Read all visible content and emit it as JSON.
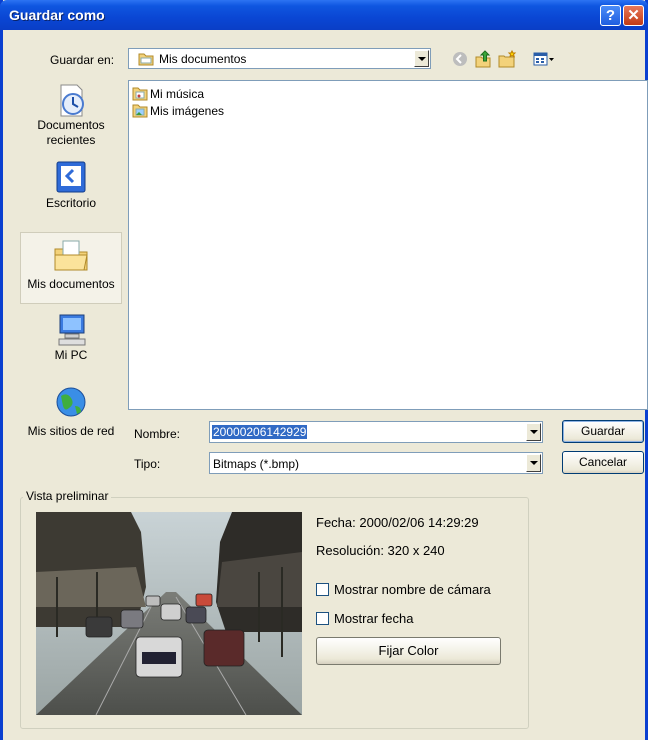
{
  "window": {
    "title": "Guardar como",
    "help_glyph": "?",
    "close_glyph": "✕"
  },
  "lookin": {
    "label": "Guardar en:",
    "value": "Mis documentos"
  },
  "toolbar": {
    "icons": [
      "back-icon",
      "up-folder-icon",
      "new-folder-icon",
      "view-menu-icon"
    ]
  },
  "places": [
    {
      "label": "Documentos recientes",
      "icon": "recent-documents-icon"
    },
    {
      "label": "Escritorio",
      "icon": "desktop-icon"
    },
    {
      "label": "Mis documentos",
      "icon": "my-documents-icon",
      "selected": true
    },
    {
      "label": "Mi PC",
      "icon": "my-computer-icon"
    },
    {
      "label": "Mis sitios de red",
      "icon": "network-places-icon"
    }
  ],
  "files": [
    {
      "name": "Mi música",
      "icon": "music-folder-icon"
    },
    {
      "name": "Mis imágenes",
      "icon": "pictures-folder-icon"
    }
  ],
  "filename": {
    "label": "Nombre:",
    "value": "20000206142929"
  },
  "filetype": {
    "label": "Tipo:",
    "value": "Bitmaps (*.bmp)"
  },
  "buttons": {
    "save": "Guardar",
    "cancel": "Cancelar"
  },
  "preview": {
    "group_title": "Vista preliminar",
    "date": "Fecha: 2000/02/06 14:29:29",
    "resolution": "Resolución: 320 x 240",
    "show_camera": {
      "label": "Mostrar nombre de cámara",
      "checked": false
    },
    "show_date": {
      "label": "Mostrar fecha",
      "checked": false
    },
    "color_button": "Fijar Color"
  },
  "colors": {
    "titlebar": "#0a46d4",
    "dialog_bg": "#ece9d8",
    "selection": "#316ac5"
  }
}
